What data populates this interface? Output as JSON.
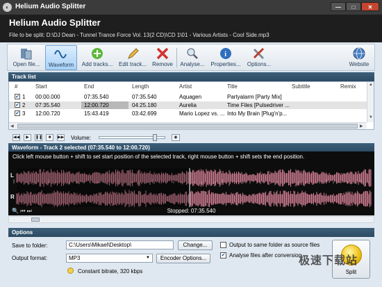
{
  "window": {
    "title": "Helium Audio Splitter",
    "minimize": "—",
    "maximize": "□",
    "close": "✕"
  },
  "header": {
    "app_title": "Helium Audio Splitter",
    "file_line": "File to be split: D:\\DJ Dean - Tunnel Trance Force Vol. 13(2 CD)\\CD 1\\01 - Various Artists - Cool Side.mp3"
  },
  "toolbar": {
    "items": [
      {
        "label": "Open file...",
        "icon": "open-file-icon"
      },
      {
        "label": "Waveform",
        "icon": "waveform-icon"
      },
      {
        "label": "Add tracks...",
        "icon": "add-icon"
      },
      {
        "label": "Edit track...",
        "icon": "pencil-icon"
      },
      {
        "label": "Remove",
        "icon": "remove-icon"
      },
      {
        "label": "Analyse...",
        "icon": "magnifier-icon"
      },
      {
        "label": "Properties...",
        "icon": "info-icon"
      },
      {
        "label": "Options...",
        "icon": "tools-icon"
      },
      {
        "label": "Website",
        "icon": "globe-icon"
      }
    ]
  },
  "tracklist": {
    "title": "Track list",
    "columns": [
      "#",
      "Start",
      "End",
      "Length",
      "Artist",
      "Title",
      "Subtitle",
      "Remix"
    ],
    "rows": [
      {
        "num": "1",
        "start": "00:00.000",
        "end": "07:35.540",
        "length": "07:35.540",
        "artist": "Aquagen",
        "title": "Partyalarm [Party Mix]",
        "subtitle": "",
        "remix": ""
      },
      {
        "num": "2",
        "start": "07:35.540",
        "end": "12:00.720",
        "length": "04:25.180",
        "artist": "Aurelia",
        "title": "Time Files [Pulsedriver ...",
        "subtitle": "",
        "remix": ""
      },
      {
        "num": "3",
        "start": "12:00.720",
        "end": "15:43.419",
        "length": "03:42.699",
        "artist": "Mario Lopez vs. ...",
        "title": "Into My Brain [Plug'n'p...",
        "subtitle": "",
        "remix": ""
      }
    ],
    "selected_row": 1
  },
  "player": {
    "volume_label": "Volume:",
    "volume_level": 0.88
  },
  "waveform": {
    "title": "Waveform - Track 2 selected (07:35.540 to 12:00.720)",
    "hint": "Click left mouse button + shift to set start position of the selected track, right mouse button + shift sets the end position.",
    "channel_left": "L",
    "channel_right": "R",
    "status": "Stopped: 07:35.540",
    "colors": {
      "background": "#0d0d0d",
      "wave": "#c97a8f",
      "wave_dim": "#7a3d4d",
      "cursor": "#ffffff"
    }
  },
  "options": {
    "title": "Options",
    "save_label": "Save to folder:",
    "save_value": "C:\\Users\\Mikael\\Desktop\\",
    "change_button": "Change...",
    "format_label": "Output format:",
    "format_value": "MP3",
    "encoder_button": "Encoder Options...",
    "bitrate_text": "Constant bitrate, 320 kbps",
    "same_folder_label": "Output to same folder as source files",
    "same_folder_checked": false,
    "analyse_label": "Analyse files after conversion",
    "analyse_checked": true,
    "split_button": "Split"
  },
  "watermark": "极速下载站"
}
